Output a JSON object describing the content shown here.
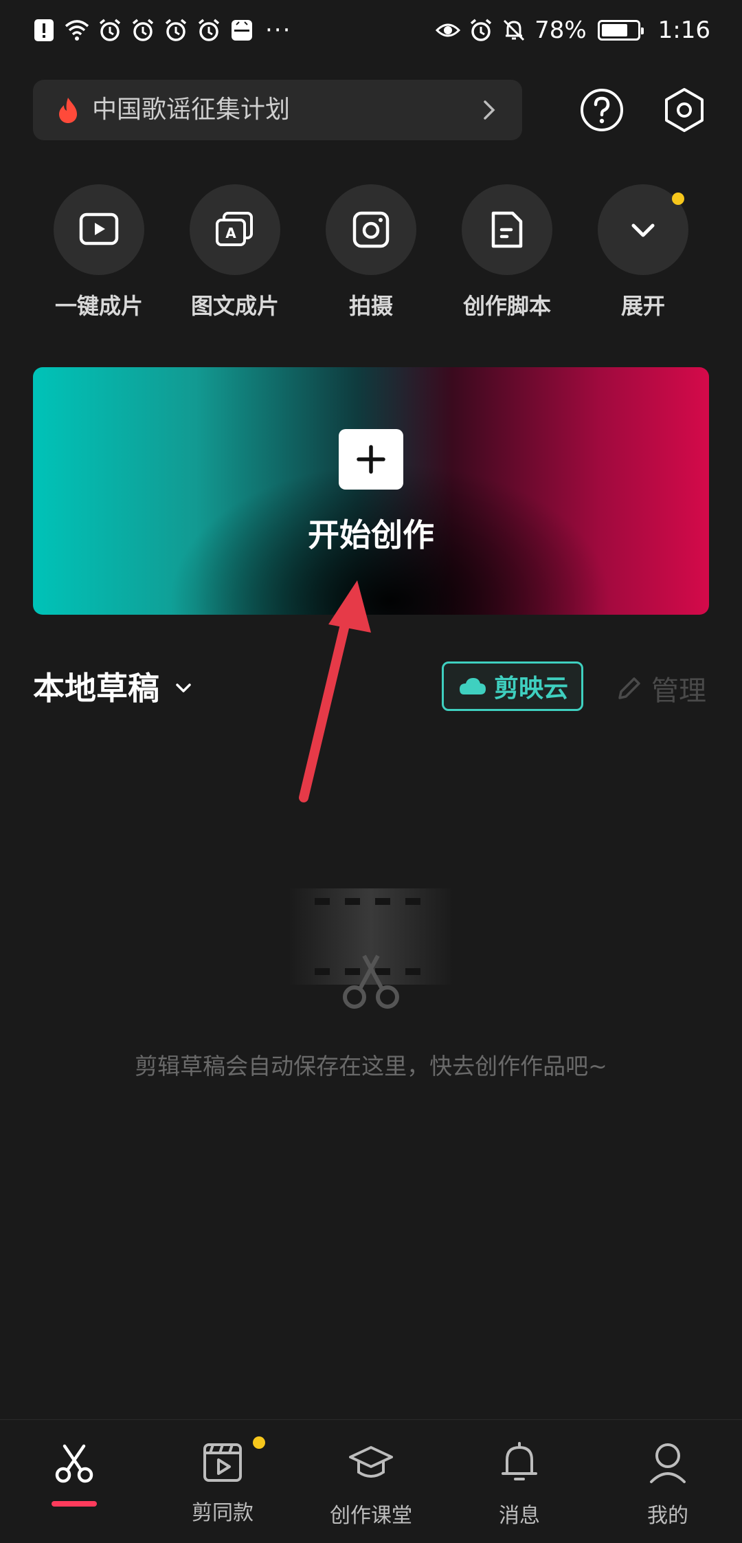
{
  "status_bar": {
    "battery_percent": "78%",
    "time": "1:16",
    "more_indicator": "···",
    "battery_level": 0.78,
    "icons": [
      "alert-icon",
      "wifi-icon",
      "alarm-icon",
      "alarm-icon",
      "alarm-icon",
      "alarm-icon",
      "huawei-icon",
      "eye-icon",
      "alarm-icon",
      "mute-icon",
      "battery-icon"
    ]
  },
  "banner": {
    "text": "中国歌谣征集计划",
    "icon": "fire-icon"
  },
  "quick_actions": [
    {
      "label": "一键成片",
      "icon": "play-icon"
    },
    {
      "label": "图文成片",
      "icon": "text-image-icon"
    },
    {
      "label": "拍摄",
      "icon": "camera-icon"
    },
    {
      "label": "创作脚本",
      "icon": "script-icon"
    },
    {
      "label": "展开",
      "icon": "chevron-down-icon"
    }
  ],
  "hero": {
    "label": "开始创作",
    "icon": "plus-icon"
  },
  "drafts": {
    "title": "本地草稿",
    "cloud_label": "剪映云",
    "manage_label": "管理",
    "empty_text": "剪辑草稿会自动保存在这里，快去创作作品吧~"
  },
  "bottom_nav": [
    {
      "label": "",
      "icon": "scissors-icon",
      "active": true
    },
    {
      "label": "剪同款",
      "icon": "template-icon",
      "badge": true
    },
    {
      "label": "创作课堂",
      "icon": "graduation-icon"
    },
    {
      "label": "消息",
      "icon": "bell-icon"
    },
    {
      "label": "我的",
      "icon": "profile-icon"
    }
  ],
  "colors": {
    "background": "#1a1a1a",
    "accent_teal": "#3fd0c0",
    "accent_red": "#ff3b5c",
    "badge_yellow": "#f7c71c"
  }
}
